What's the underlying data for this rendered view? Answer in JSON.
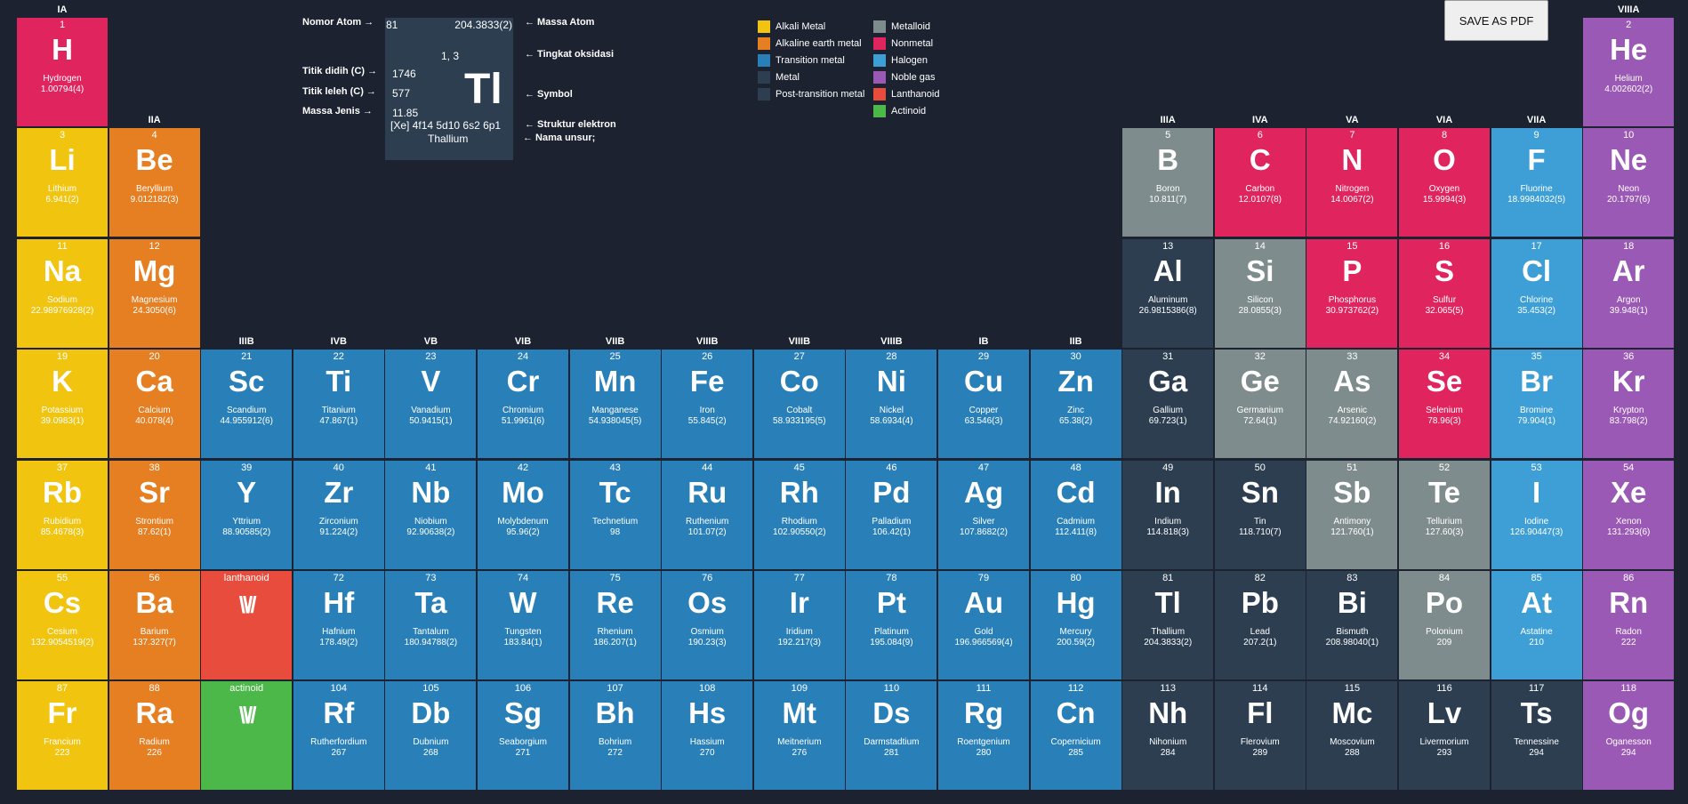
{
  "colors": {
    "background": "#1c2230",
    "alkali": "#f1c40f",
    "alkaline": "#e67e22",
    "transition": "#2980b9",
    "metal": "#2c3e50",
    "post_transition": "#2c3e50",
    "metalloid": "#7f8c8d",
    "nonmetal": "#e0245e",
    "halogen": "#3e9fd6",
    "noble": "#9b59b6",
    "lanthanoid": "#e74c3c",
    "actinoid": "#4cb849"
  },
  "save_button": {
    "label": "SAVE AS PDF"
  },
  "key": {
    "labels": {
      "atomic_number": "Nomor Atom →",
      "boiling": "Titik didih (C) →",
      "melting": "Titik leleh (C) →",
      "density": "Massa Jenis →",
      "atomic_mass": "← Massa Atom",
      "oxidation": "← Tingkat oksidasi",
      "symbol": "← Symbol",
      "config": "← Struktur elektron",
      "name": "← Nama unsur;"
    },
    "sample": {
      "number": "81",
      "mass": "204.3833(2)",
      "oxidation": "1, 3",
      "boiling": "1746",
      "melting": "577",
      "density": "11.85",
      "symbol": "Tl",
      "config": "[Xe] 4f14 5d10 6s2 6p1",
      "name": "Thallium"
    }
  },
  "legend": [
    {
      "label": "Alkali Metal",
      "color": "#f1c40f"
    },
    {
      "label": "Alkaline earth metal",
      "color": "#e67e22"
    },
    {
      "label": "Transition metal",
      "color": "#2980b9"
    },
    {
      "label": "Metal",
      "color": "#2c3e50"
    },
    {
      "label": "Post-transition metal",
      "color": "#2c3e50"
    },
    {
      "label": "Metalloid",
      "color": "#7f8c8d"
    },
    {
      "label": "Nonmetal",
      "color": "#e0245e"
    },
    {
      "label": "Halogen",
      "color": "#3e9fd6"
    },
    {
      "label": "Noble gas",
      "color": "#9b59b6"
    },
    {
      "label": "Lanthanoid",
      "color": "#e74c3c"
    },
    {
      "label": "Actinoid",
      "color": "#4cb849"
    }
  ],
  "groups": [
    {
      "label": "IA",
      "col": 1,
      "row": 1
    },
    {
      "label": "IIA",
      "col": 2,
      "row": 2
    },
    {
      "label": "IIIB",
      "col": 3,
      "row": 4
    },
    {
      "label": "IVB",
      "col": 4,
      "row": 4
    },
    {
      "label": "VB",
      "col": 5,
      "row": 4
    },
    {
      "label": "VIB",
      "col": 6,
      "row": 4
    },
    {
      "label": "VIIB",
      "col": 7,
      "row": 4
    },
    {
      "label": "VIIIB",
      "col": 8,
      "row": 4
    },
    {
      "label": "VIIIB",
      "col": 9,
      "row": 4
    },
    {
      "label": "VIIIB",
      "col": 10,
      "row": 4
    },
    {
      "label": "IB",
      "col": 11,
      "row": 4
    },
    {
      "label": "IIB",
      "col": 12,
      "row": 4
    },
    {
      "label": "IIIA",
      "col": 13,
      "row": 2
    },
    {
      "label": "IVA",
      "col": 14,
      "row": 2
    },
    {
      "label": "VA",
      "col": 15,
      "row": 2
    },
    {
      "label": "VIA",
      "col": 16,
      "row": 2
    },
    {
      "label": "VIIA",
      "col": 17,
      "row": 2
    },
    {
      "label": "VIIIA",
      "col": 18,
      "row": 1
    }
  ],
  "elements": [
    {
      "n": "1",
      "s": "H",
      "name": "Hydrogen",
      "mass": "1.00794(4)",
      "col": 1,
      "row": 1,
      "cat": "nonmetal"
    },
    {
      "n": "2",
      "s": "He",
      "name": "Helium",
      "mass": "4.002602(2)",
      "col": 18,
      "row": 1,
      "cat": "noble"
    },
    {
      "n": "3",
      "s": "Li",
      "name": "Lithium",
      "mass": "6.941(2)",
      "col": 1,
      "row": 2,
      "cat": "alkali"
    },
    {
      "n": "4",
      "s": "Be",
      "name": "Beryllium",
      "mass": "9.012182(3)",
      "col": 2,
      "row": 2,
      "cat": "alkaline"
    },
    {
      "n": "5",
      "s": "B",
      "name": "Boron",
      "mass": "10.811(7)",
      "col": 13,
      "row": 2,
      "cat": "metalloid"
    },
    {
      "n": "6",
      "s": "C",
      "name": "Carbon",
      "mass": "12.0107(8)",
      "col": 14,
      "row": 2,
      "cat": "nonmetal"
    },
    {
      "n": "7",
      "s": "N",
      "name": "Nitrogen",
      "mass": "14.0067(2)",
      "col": 15,
      "row": 2,
      "cat": "nonmetal"
    },
    {
      "n": "8",
      "s": "O",
      "name": "Oxygen",
      "mass": "15.9994(3)",
      "col": 16,
      "row": 2,
      "cat": "nonmetal"
    },
    {
      "n": "9",
      "s": "F",
      "name": "Fluorine",
      "mass": "18.9984032(5)",
      "col": 17,
      "row": 2,
      "cat": "halogen"
    },
    {
      "n": "10",
      "s": "Ne",
      "name": "Neon",
      "mass": "20.1797(6)",
      "col": 18,
      "row": 2,
      "cat": "noble"
    },
    {
      "n": "11",
      "s": "Na",
      "name": "Sodium",
      "mass": "22.98976928(2)",
      "col": 1,
      "row": 3,
      "cat": "alkali"
    },
    {
      "n": "12",
      "s": "Mg",
      "name": "Magnesium",
      "mass": "24.3050(6)",
      "col": 2,
      "row": 3,
      "cat": "alkaline"
    },
    {
      "n": "13",
      "s": "Al",
      "name": "Aluminum",
      "mass": "26.9815386(8)",
      "col": 13,
      "row": 3,
      "cat": "metal"
    },
    {
      "n": "14",
      "s": "Si",
      "name": "Silicon",
      "mass": "28.0855(3)",
      "col": 14,
      "row": 3,
      "cat": "metalloid"
    },
    {
      "n": "15",
      "s": "P",
      "name": "Phosphorus",
      "mass": "30.973762(2)",
      "col": 15,
      "row": 3,
      "cat": "nonmetal"
    },
    {
      "n": "16",
      "s": "S",
      "name": "Sulfur",
      "mass": "32.065(5)",
      "col": 16,
      "row": 3,
      "cat": "nonmetal"
    },
    {
      "n": "17",
      "s": "Cl",
      "name": "Chlorine",
      "mass": "35.453(2)",
      "col": 17,
      "row": 3,
      "cat": "halogen"
    },
    {
      "n": "18",
      "s": "Ar",
      "name": "Argon",
      "mass": "39.948(1)",
      "col": 18,
      "row": 3,
      "cat": "noble"
    },
    {
      "n": "19",
      "s": "K",
      "name": "Potassium",
      "mass": "39.0983(1)",
      "col": 1,
      "row": 4,
      "cat": "alkali"
    },
    {
      "n": "20",
      "s": "Ca",
      "name": "Calcium",
      "mass": "40.078(4)",
      "col": 2,
      "row": 4,
      "cat": "alkaline"
    },
    {
      "n": "21",
      "s": "Sc",
      "name": "Scandium",
      "mass": "44.955912(6)",
      "col": 3,
      "row": 4,
      "cat": "transition"
    },
    {
      "n": "22",
      "s": "Ti",
      "name": "Titanium",
      "mass": "47.867(1)",
      "col": 4,
      "row": 4,
      "cat": "transition"
    },
    {
      "n": "23",
      "s": "V",
      "name": "Vanadium",
      "mass": "50.9415(1)",
      "col": 5,
      "row": 4,
      "cat": "transition"
    },
    {
      "n": "24",
      "s": "Cr",
      "name": "Chromium",
      "mass": "51.9961(6)",
      "col": 6,
      "row": 4,
      "cat": "transition"
    },
    {
      "n": "25",
      "s": "Mn",
      "name": "Manganese",
      "mass": "54.938045(5)",
      "col": 7,
      "row": 4,
      "cat": "transition"
    },
    {
      "n": "26",
      "s": "Fe",
      "name": "Iron",
      "mass": "55.845(2)",
      "col": 8,
      "row": 4,
      "cat": "transition"
    },
    {
      "n": "27",
      "s": "Co",
      "name": "Cobalt",
      "mass": "58.933195(5)",
      "col": 9,
      "row": 4,
      "cat": "transition"
    },
    {
      "n": "28",
      "s": "Ni",
      "name": "Nickel",
      "mass": "58.6934(4)",
      "col": 10,
      "row": 4,
      "cat": "transition"
    },
    {
      "n": "29",
      "s": "Cu",
      "name": "Copper",
      "mass": "63.546(3)",
      "col": 11,
      "row": 4,
      "cat": "transition"
    },
    {
      "n": "30",
      "s": "Zn",
      "name": "Zinc",
      "mass": "65.38(2)",
      "col": 12,
      "row": 4,
      "cat": "transition"
    },
    {
      "n": "31",
      "s": "Ga",
      "name": "Gallium",
      "mass": "69.723(1)",
      "col": 13,
      "row": 4,
      "cat": "metal"
    },
    {
      "n": "32",
      "s": "Ge",
      "name": "Germanium",
      "mass": "72.64(1)",
      "col": 14,
      "row": 4,
      "cat": "metalloid"
    },
    {
      "n": "33",
      "s": "As",
      "name": "Arsenic",
      "mass": "74.92160(2)",
      "col": 15,
      "row": 4,
      "cat": "metalloid"
    },
    {
      "n": "34",
      "s": "Se",
      "name": "Selenium",
      "mass": "78.96(3)",
      "col": 16,
      "row": 4,
      "cat": "nonmetal"
    },
    {
      "n": "35",
      "s": "Br",
      "name": "Bromine",
      "mass": "79.904(1)",
      "col": 17,
      "row": 4,
      "cat": "halogen"
    },
    {
      "n": "36",
      "s": "Kr",
      "name": "Krypton",
      "mass": "83.798(2)",
      "col": 18,
      "row": 4,
      "cat": "noble"
    },
    {
      "n": "37",
      "s": "Rb",
      "name": "Rubidium",
      "mass": "85.4678(3)",
      "col": 1,
      "row": 5,
      "cat": "alkali"
    },
    {
      "n": "38",
      "s": "Sr",
      "name": "Strontium",
      "mass": "87.62(1)",
      "col": 2,
      "row": 5,
      "cat": "alkaline"
    },
    {
      "n": "39",
      "s": "Y",
      "name": "Yttrium",
      "mass": "88.90585(2)",
      "col": 3,
      "row": 5,
      "cat": "transition"
    },
    {
      "n": "40",
      "s": "Zr",
      "name": "Zirconium",
      "mass": "91.224(2)",
      "col": 4,
      "row": 5,
      "cat": "transition"
    },
    {
      "n": "41",
      "s": "Nb",
      "name": "Niobium",
      "mass": "92.90638(2)",
      "col": 5,
      "row": 5,
      "cat": "transition"
    },
    {
      "n": "42",
      "s": "Mo",
      "name": "Molybdenum",
      "mass": "95.96(2)",
      "col": 6,
      "row": 5,
      "cat": "transition"
    },
    {
      "n": "43",
      "s": "Tc",
      "name": "Technetium",
      "mass": "98",
      "col": 7,
      "row": 5,
      "cat": "transition"
    },
    {
      "n": "44",
      "s": "Ru",
      "name": "Ruthenium",
      "mass": "101.07(2)",
      "col": 8,
      "row": 5,
      "cat": "transition"
    },
    {
      "n": "45",
      "s": "Rh",
      "name": "Rhodium",
      "mass": "102.90550(2)",
      "col": 9,
      "row": 5,
      "cat": "transition"
    },
    {
      "n": "46",
      "s": "Pd",
      "name": "Palladium",
      "mass": "106.42(1)",
      "col": 10,
      "row": 5,
      "cat": "transition"
    },
    {
      "n": "47",
      "s": "Ag",
      "name": "Silver",
      "mass": "107.8682(2)",
      "col": 11,
      "row": 5,
      "cat": "transition"
    },
    {
      "n": "48",
      "s": "Cd",
      "name": "Cadmium",
      "mass": "112.411(8)",
      "col": 12,
      "row": 5,
      "cat": "transition"
    },
    {
      "n": "49",
      "s": "In",
      "name": "Indium",
      "mass": "114.818(3)",
      "col": 13,
      "row": 5,
      "cat": "metal"
    },
    {
      "n": "50",
      "s": "Sn",
      "name": "Tin",
      "mass": "118.710(7)",
      "col": 14,
      "row": 5,
      "cat": "metal"
    },
    {
      "n": "51",
      "s": "Sb",
      "name": "Antimony",
      "mass": "121.760(1)",
      "col": 15,
      "row": 5,
      "cat": "metalloid"
    },
    {
      "n": "52",
      "s": "Te",
      "name": "Tellurium",
      "mass": "127.60(3)",
      "col": 16,
      "row": 5,
      "cat": "metalloid"
    },
    {
      "n": "53",
      "s": "I",
      "name": "Iodine",
      "mass": "126.90447(3)",
      "col": 17,
      "row": 5,
      "cat": "halogen"
    },
    {
      "n": "54",
      "s": "Xe",
      "name": "Xenon",
      "mass": "131.293(6)",
      "col": 18,
      "row": 5,
      "cat": "noble"
    },
    {
      "n": "55",
      "s": "Cs",
      "name": "Cesium",
      "mass": "132.9054519(2)",
      "col": 1,
      "row": 6,
      "cat": "alkali"
    },
    {
      "n": "56",
      "s": "Ba",
      "name": "Barium",
      "mass": "137.327(7)",
      "col": 2,
      "row": 6,
      "cat": "alkaline"
    },
    {
      "n": "lanthanoid",
      "s": "\\\\//",
      "name": "",
      "mass": "",
      "col": 3,
      "row": 6,
      "cat": "lanthanoid",
      "placeholder": true
    },
    {
      "n": "72",
      "s": "Hf",
      "name": "Hafnium",
      "mass": "178.49(2)",
      "col": 4,
      "row": 6,
      "cat": "transition"
    },
    {
      "n": "73",
      "s": "Ta",
      "name": "Tantalum",
      "mass": "180.94788(2)",
      "col": 5,
      "row": 6,
      "cat": "transition"
    },
    {
      "n": "74",
      "s": "W",
      "name": "Tungsten",
      "mass": "183.84(1)",
      "col": 6,
      "row": 6,
      "cat": "transition"
    },
    {
      "n": "75",
      "s": "Re",
      "name": "Rhenium",
      "mass": "186.207(1)",
      "col": 7,
      "row": 6,
      "cat": "transition"
    },
    {
      "n": "76",
      "s": "Os",
      "name": "Osmium",
      "mass": "190.23(3)",
      "col": 8,
      "row": 6,
      "cat": "transition"
    },
    {
      "n": "77",
      "s": "Ir",
      "name": "Iridium",
      "mass": "192.217(3)",
      "col": 9,
      "row": 6,
      "cat": "transition"
    },
    {
      "n": "78",
      "s": "Pt",
      "name": "Platinum",
      "mass": "195.084(9)",
      "col": 10,
      "row": 6,
      "cat": "transition"
    },
    {
      "n": "79",
      "s": "Au",
      "name": "Gold",
      "mass": "196.966569(4)",
      "col": 11,
      "row": 6,
      "cat": "transition"
    },
    {
      "n": "80",
      "s": "Hg",
      "name": "Mercury",
      "mass": "200.59(2)",
      "col": 12,
      "row": 6,
      "cat": "transition"
    },
    {
      "n": "81",
      "s": "Tl",
      "name": "Thallium",
      "mass": "204.3833(2)",
      "col": 13,
      "row": 6,
      "cat": "metal"
    },
    {
      "n": "82",
      "s": "Pb",
      "name": "Lead",
      "mass": "207.2(1)",
      "col": 14,
      "row": 6,
      "cat": "metal"
    },
    {
      "n": "83",
      "s": "Bi",
      "name": "Bismuth",
      "mass": "208.98040(1)",
      "col": 15,
      "row": 6,
      "cat": "metal"
    },
    {
      "n": "84",
      "s": "Po",
      "name": "Polonium",
      "mass": "209",
      "col": 16,
      "row": 6,
      "cat": "metalloid"
    },
    {
      "n": "85",
      "s": "At",
      "name": "Astatine",
      "mass": "210",
      "col": 17,
      "row": 6,
      "cat": "halogen"
    },
    {
      "n": "86",
      "s": "Rn",
      "name": "Radon",
      "mass": "222",
      "col": 18,
      "row": 6,
      "cat": "noble"
    },
    {
      "n": "87",
      "s": "Fr",
      "name": "Francium",
      "mass": "223",
      "col": 1,
      "row": 7,
      "cat": "alkali"
    },
    {
      "n": "88",
      "s": "Ra",
      "name": "Radium",
      "mass": "226",
      "col": 2,
      "row": 7,
      "cat": "alkaline"
    },
    {
      "n": "actinoid",
      "s": "\\\\//",
      "name": "",
      "mass": "",
      "col": 3,
      "row": 7,
      "cat": "actinoid",
      "placeholder": true
    },
    {
      "n": "104",
      "s": "Rf",
      "name": "Rutherfordium",
      "mass": "267",
      "col": 4,
      "row": 7,
      "cat": "transition"
    },
    {
      "n": "105",
      "s": "Db",
      "name": "Dubnium",
      "mass": "268",
      "col": 5,
      "row": 7,
      "cat": "transition"
    },
    {
      "n": "106",
      "s": "Sg",
      "name": "Seaborgium",
      "mass": "271",
      "col": 6,
      "row": 7,
      "cat": "transition"
    },
    {
      "n": "107",
      "s": "Bh",
      "name": "Bohrium",
      "mass": "272",
      "col": 7,
      "row": 7,
      "cat": "transition"
    },
    {
      "n": "108",
      "s": "Hs",
      "name": "Hassium",
      "mass": "270",
      "col": 8,
      "row": 7,
      "cat": "transition"
    },
    {
      "n": "109",
      "s": "Mt",
      "name": "Meitnerium",
      "mass": "276",
      "col": 9,
      "row": 7,
      "cat": "transition"
    },
    {
      "n": "110",
      "s": "Ds",
      "name": "Darmstadtium",
      "mass": "281",
      "col": 10,
      "row": 7,
      "cat": "transition"
    },
    {
      "n": "111",
      "s": "Rg",
      "name": "Roentgenium",
      "mass": "280",
      "col": 11,
      "row": 7,
      "cat": "transition"
    },
    {
      "n": "112",
      "s": "Cn",
      "name": "Copernicium",
      "mass": "285",
      "col": 12,
      "row": 7,
      "cat": "transition"
    },
    {
      "n": "113",
      "s": "Nh",
      "name": "Nihonium",
      "mass": "284",
      "col": 13,
      "row": 7,
      "cat": "metal"
    },
    {
      "n": "114",
      "s": "Fl",
      "name": "Flerovium",
      "mass": "289",
      "col": 14,
      "row": 7,
      "cat": "metal"
    },
    {
      "n": "115",
      "s": "Mc",
      "name": "Moscovium",
      "mass": "288",
      "col": 15,
      "row": 7,
      "cat": "metal"
    },
    {
      "n": "116",
      "s": "Lv",
      "name": "Livermorium",
      "mass": "293",
      "col": 16,
      "row": 7,
      "cat": "metal"
    },
    {
      "n": "117",
      "s": "Ts",
      "name": "Tennessine",
      "mass": "294",
      "col": 17,
      "row": 7,
      "cat": "metal"
    },
    {
      "n": "118",
      "s": "Og",
      "name": "Oganesson",
      "mass": "294",
      "col": 18,
      "row": 7,
      "cat": "noble"
    }
  ]
}
